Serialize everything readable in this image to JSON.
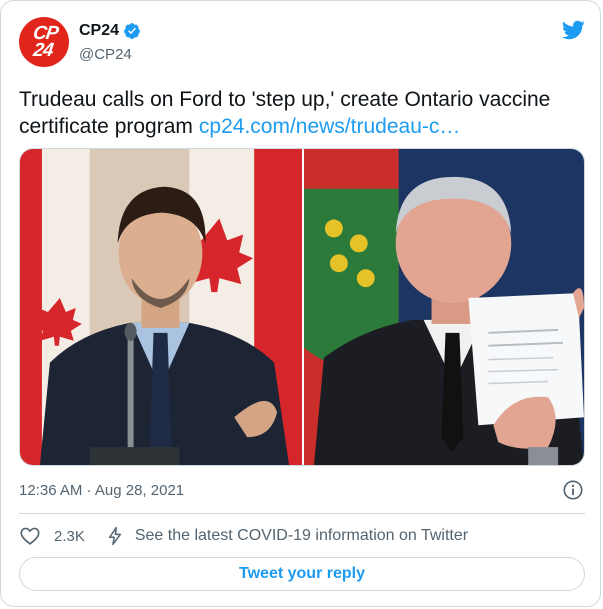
{
  "tweet": {
    "display_name": "CP24",
    "handle": "@CP24",
    "avatar_logo_text": "CP24",
    "text": "Trudeau calls on Ford to 'step up,' create Ontario vaccine certificate program",
    "link": "cp24.com/news/trudeau-c…",
    "timestamp": "12:36 AM · Aug 28, 2021",
    "like_count": "2.3K",
    "covid_info_link": "See the latest COVID-19 information on Twitter",
    "reply_button": "Tweet your reply"
  },
  "icons": {
    "verified": "verified-badge-icon",
    "brand": "twitter-bird-icon",
    "info": "info-icon",
    "like": "heart-icon",
    "covid": "lightning-bolt-icon"
  },
  "colors": {
    "accent": "#1d9bf0",
    "brand_red": "#e1251b",
    "muted_text": "#536471",
    "border": "#cfd9de"
  }
}
